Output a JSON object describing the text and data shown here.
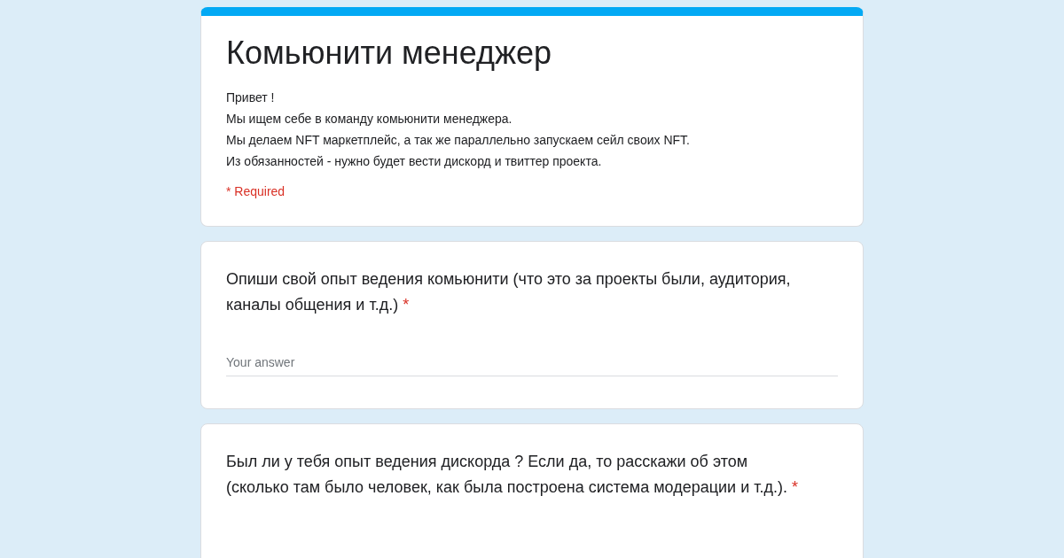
{
  "form": {
    "title": "Комьюнити менеджер",
    "description_lines": [
      "Привет !",
      "Мы ищем себе в команду комьюнити менеджера.",
      "Мы делаем NFT маркетплейс, а так же параллельно запускаем сейл своих NFT.",
      "Из обязанностей - нужно будет вести дискорд и твиттер проекта."
    ],
    "required_note": "* Required"
  },
  "questions": [
    {
      "text": "Опиши свой опыт ведения комьюнити (что это за проекты были, аудитория, каналы общения и т.д.)",
      "required_mark": "*",
      "placeholder": "Your answer"
    },
    {
      "text": "Был ли у тебя опыт ведения дискорда ? Если да, то расскажи об этом (сколько там было человек, как была построена система модерации и т.д.).",
      "required_mark": "*"
    }
  ]
}
